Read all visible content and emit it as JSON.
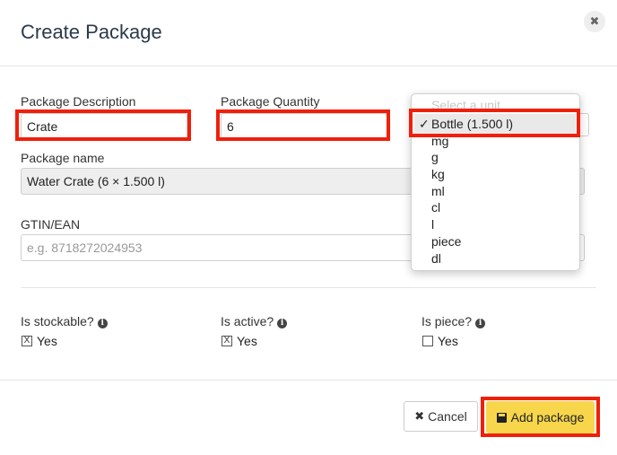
{
  "modal": {
    "title": "Create Package",
    "close_icon": "✖"
  },
  "form": {
    "description": {
      "label": "Package Description",
      "value": "Crate"
    },
    "quantity": {
      "label": "Package Quantity",
      "value": "6"
    },
    "unit": {
      "placeholder": "Select a unit",
      "selected": "Bottle (1.500 l)",
      "check": "✓",
      "options": [
        "mg",
        "g",
        "kg",
        "ml",
        "cl",
        "l",
        "piece",
        "dl"
      ]
    },
    "name": {
      "label": "Package name",
      "value": "Water Crate (6 × 1.500 l)"
    },
    "gtin": {
      "label": "GTIN/EAN",
      "placeholder": "e.g. 8718272024953"
    }
  },
  "flags": {
    "stockable": {
      "label": "Is stockable?",
      "option": "Yes",
      "checked": true,
      "mark": "X"
    },
    "active": {
      "label": "Is active?",
      "option": "Yes",
      "checked": true,
      "mark": "X"
    },
    "piece": {
      "label": "Is piece?",
      "option": "Yes",
      "checked": false,
      "mark": ""
    }
  },
  "info_icon": "i",
  "footer": {
    "cancel_label": "Cancel",
    "cancel_icon": "✖",
    "add_label": "Add package"
  },
  "highlight_color": "#f01f0a",
  "accent_color": "#f7d64c"
}
